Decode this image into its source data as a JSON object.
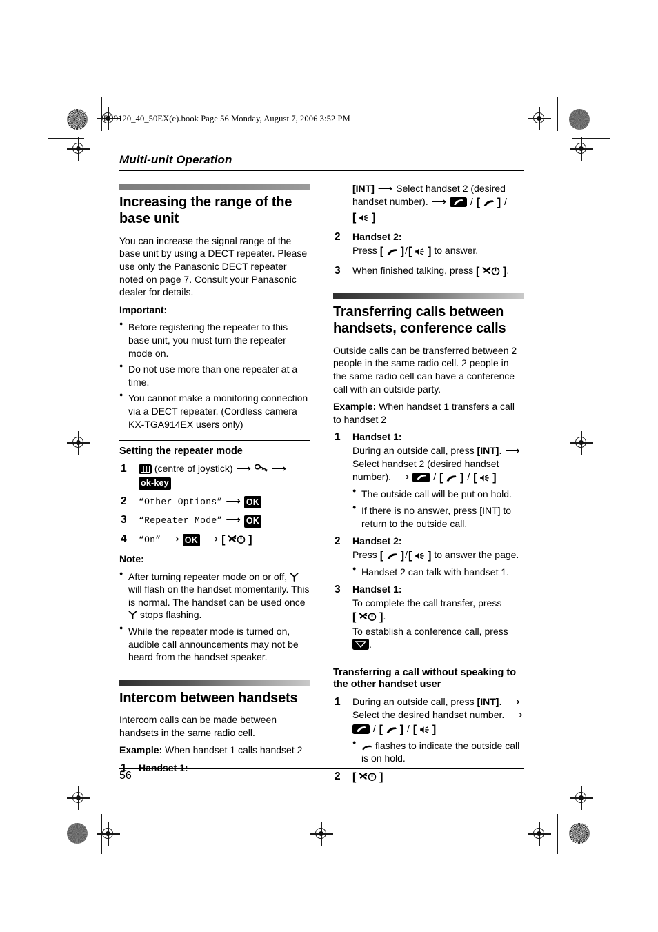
{
  "file_header": "TG9120_40_50EX(e).book  Page 56  Monday, August 7, 2006  3:52 PM",
  "chapter_title": "Multi-unit Operation",
  "page_number": "56",
  "colors": {
    "text": "#000000",
    "background": "#ffffff",
    "heading_bar_dark": "#2e2e2e",
    "heading_bar_light": "#c9c9c9",
    "key_fill": "#000000",
    "key_text": "#ffffff"
  },
  "left_column": {
    "section_1": {
      "heading": "Increasing the range of the base unit",
      "body": "You can increase the signal range of the base unit by using a DECT repeater. Please use only the Panasonic DECT repeater noted on page 7. Consult your Panasonic dealer for details.",
      "important_label": "Important:",
      "important_bullets": [
        "Before registering the repeater to this base unit, you must turn the repeater mode on.",
        "Do not use more than one repeater at a time.",
        "You cannot make a monitoring connection via a DECT repeater. (Cordless camera KX-TGA914EX users only)"
      ],
      "sub_heading": "Setting the repeater mode",
      "steps": [
        {
          "num": "1",
          "joystick_label": "(centre of joystick)",
          "icons": [
            "menu-grid-icon",
            "arrow-right",
            "settings-tools-icon",
            "arrow-right",
            "ok-key"
          ]
        },
        {
          "num": "2",
          "lcd_text": "“Other Options”",
          "arrow": "→",
          "ok": "OK"
        },
        {
          "num": "3",
          "lcd_text": "“Repeater Mode”",
          "arrow": "→",
          "ok": "OK"
        },
        {
          "num": "4",
          "lcd_text": "“On”",
          "arrow": "→",
          "ok": "OK",
          "arrow2": "→",
          "end_key": "power-off-key"
        }
      ],
      "note_label": "Note:",
      "note_bullets": [
        {
          "parts": [
            "After turning repeater mode on or off, ",
            "[signal-antenna-icon]",
            " will flash on the handset momentarily. This is normal. The handset can be used once ",
            "[signal-antenna-icon]",
            " stops flashing."
          ],
          "text": "After turning repeater mode on or off, Ψ will flash on the handset momentarily. This is normal. The handset can be used once Ψ stops flashing."
        },
        {
          "text": "While the repeater mode is turned on, audible call announcements may not be heard from the handset speaker."
        }
      ]
    },
    "section_2": {
      "heading": "Intercom between handsets",
      "body": "Intercom calls can be made between handsets in the same radio cell.",
      "example_label": "Example:",
      "example_text": "When handset 1 calls handset 2",
      "step_num": "1",
      "step_label": "Handset 1:"
    }
  },
  "right_column": {
    "intercom_continued": {
      "step1_line1_key": "[INT]",
      "step1_line1_text": "Select handset 2 (desired handset number).",
      "step1_keys": [
        "talk-box-icon",
        "talk-bracket-key",
        "speaker-bracket-key"
      ],
      "step2_num": "2",
      "step2_label": "Handset 2:",
      "step2_text_pre": "Press ",
      "step2_text_post": " to answer.",
      "step3_num": "3",
      "step3_text_pre": "When finished talking, press ",
      "step3_text_post": "."
    },
    "section_3": {
      "heading": "Transferring calls between handsets, conference calls",
      "body": "Outside calls can be transferred between 2 people in the same radio cell. 2 people in the same radio cell can have a conference call with an outside party.",
      "example_label": "Example:",
      "example_text": "When handset 1 transfers a call to handset 2",
      "steps": [
        {
          "num": "1",
          "label": "Handset 1:",
          "text_a": "During an outside call, press ",
          "int_key": "[INT]",
          "text_b": "Select handset 2 (desired handset number).",
          "bullets": [
            "The outside call will be put on hold.",
            "If there is no answer, press [INT] to return to the outside call."
          ]
        },
        {
          "num": "2",
          "label": "Handset 2:",
          "text_pre": "Press ",
          "text_post": " to answer the page.",
          "bullets": [
            "Handset 2 can talk with handset 1."
          ]
        },
        {
          "num": "3",
          "label": "Handset 1:",
          "text_a": "To complete the call transfer, press ",
          "text_a_end": ".",
          "text_b": "To establish a conference call, press ",
          "text_b_end": "."
        }
      ],
      "sub_heading": "Transferring a call without speaking to the other handset user",
      "sub_steps": [
        {
          "num": "1",
          "text_a": "During an outside call, press ",
          "int_key": "[INT]",
          "text_b": "Select the desired handset number.",
          "bullet_pre": "",
          "bullet_post": " flashes to indicate the outside call is on hold."
        },
        {
          "num": "2",
          "key": "power-off-key"
        }
      ]
    }
  },
  "glyph_labels": {
    "int_key": "INT",
    "ok": "OK",
    "arrow_right": "→",
    "slash": "/"
  }
}
